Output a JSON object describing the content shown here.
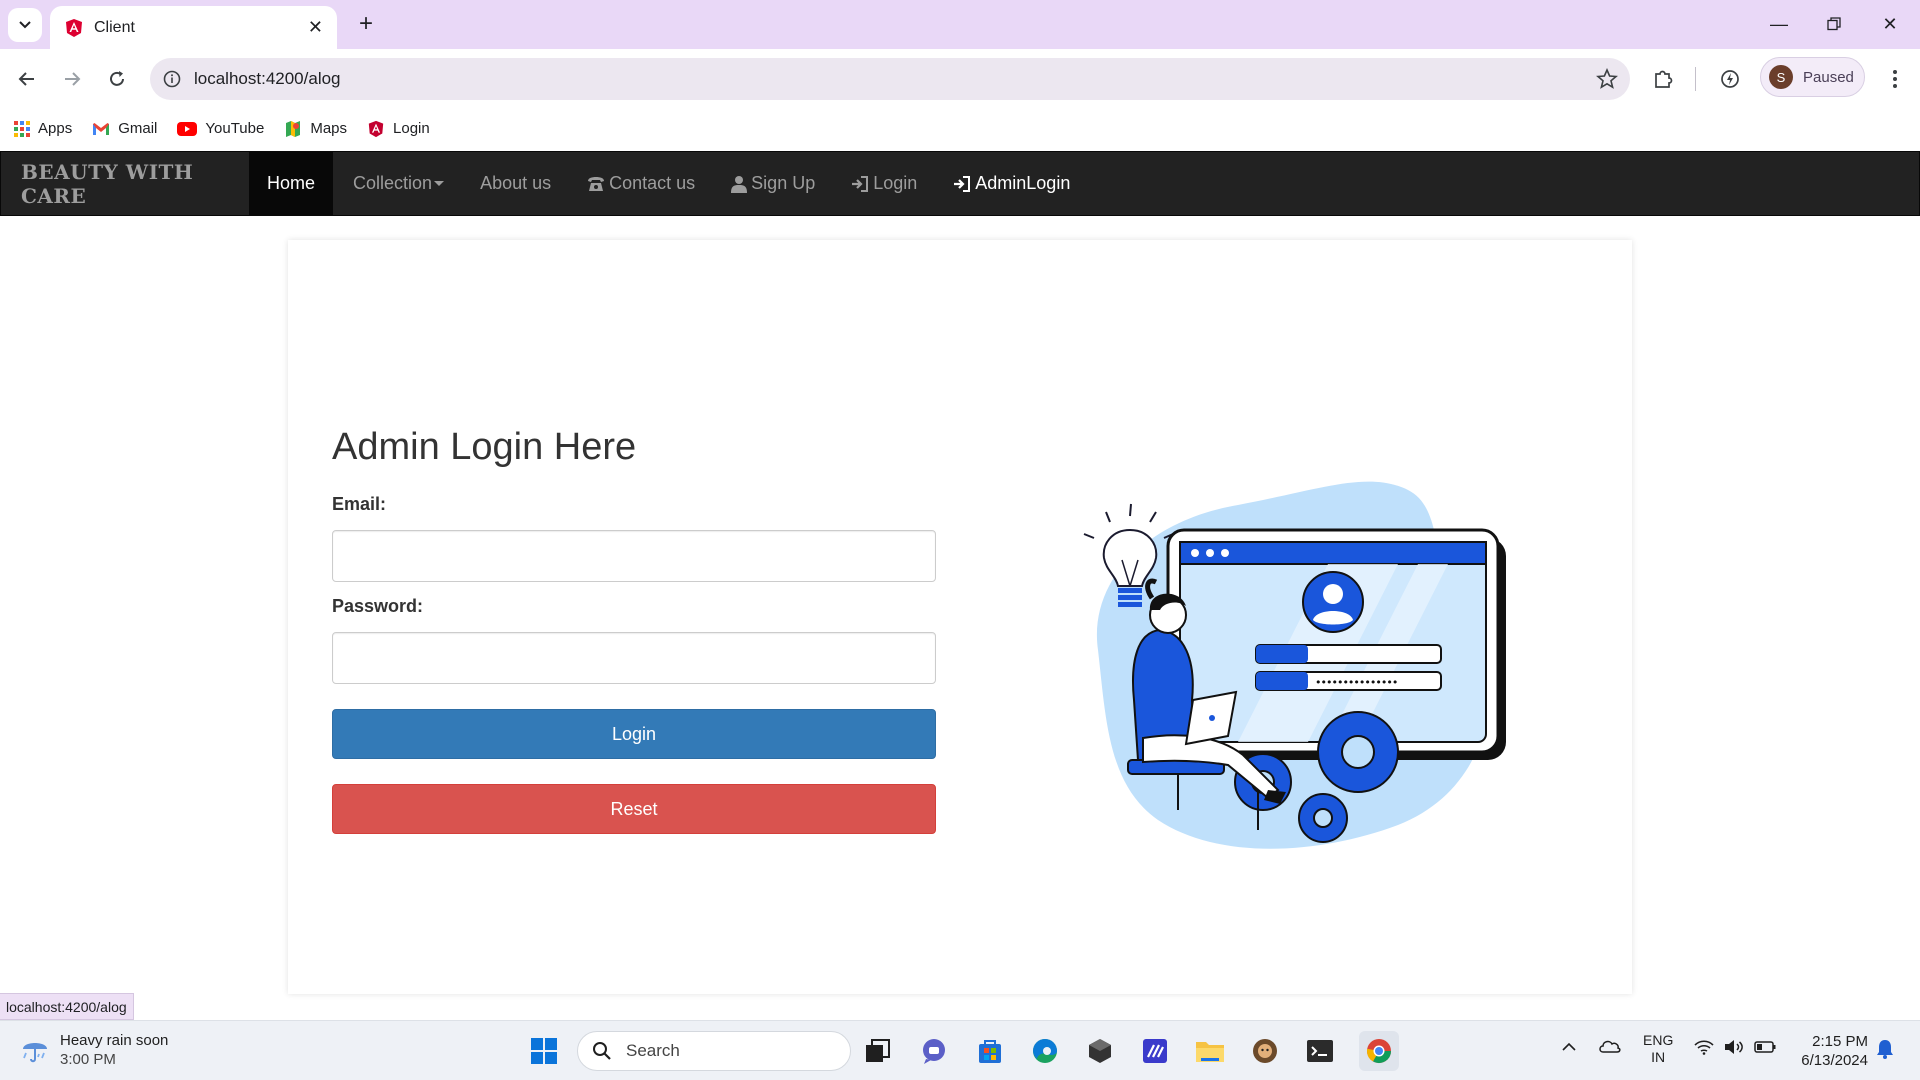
{
  "browser": {
    "tab_title": "Client",
    "url": "localhost:4200/alog",
    "profile_label": "Paused",
    "profile_initial": "S",
    "bookmarks": [
      {
        "label": "Apps",
        "icon": "apps-grid-icon"
      },
      {
        "label": "Gmail",
        "icon": "gmail-icon"
      },
      {
        "label": "YouTube",
        "icon": "youtube-icon"
      },
      {
        "label": "Maps",
        "icon": "maps-icon"
      },
      {
        "label": "Login",
        "icon": "angular-icon"
      }
    ],
    "status_url": "localhost:4200/alog"
  },
  "navbar": {
    "brand": "BEAUTY WITH CARE",
    "items": [
      {
        "label": "Home",
        "active": true
      },
      {
        "label": "Collection",
        "dropdown": true
      },
      {
        "label": "About us"
      },
      {
        "label": "Contact us",
        "icon": "phone-icon"
      },
      {
        "label": "Sign Up",
        "icon": "user-icon"
      },
      {
        "label": "Login",
        "icon": "login-icon"
      },
      {
        "label": "AdminLogin",
        "icon": "login-icon"
      }
    ]
  },
  "form": {
    "heading": "Admin Login Here",
    "email_label": "Email:",
    "email_value": "",
    "password_label": "Password:",
    "password_value": "",
    "login_button": "Login",
    "reset_button": "Reset"
  },
  "illustration": {
    "password_mask": "•••••••••••••••"
  },
  "taskbar": {
    "weather_title": "Heavy rain soon",
    "weather_time": "3:00 PM",
    "search_placeholder": "Search",
    "lang_top": "ENG",
    "lang_bottom": "IN",
    "time": "2:15 PM",
    "date": "6/13/2024"
  },
  "colors": {
    "primary": "#337ab7",
    "danger": "#d9534f",
    "navbar_bg": "#222222",
    "tabstrip_bg": "#e9d8f7",
    "illustration_blue": "#1a56db",
    "illustration_light": "#bfe0fb"
  }
}
